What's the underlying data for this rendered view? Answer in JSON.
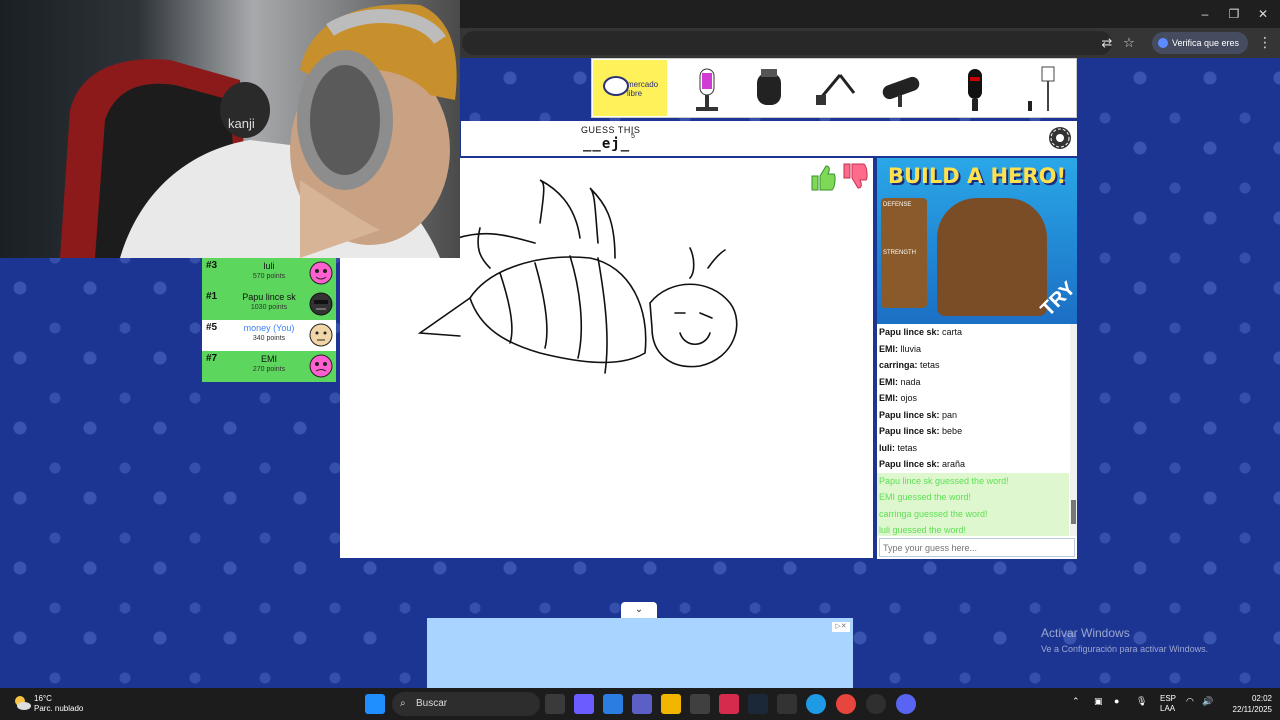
{
  "browser": {
    "window_controls": [
      "–",
      "❐",
      "✕"
    ],
    "verify_label": "Verifica que eres tú"
  },
  "ad_top": {
    "logo_text": "mercado libre",
    "icon": "mercado-libre-logo"
  },
  "game": {
    "guess_label": "GUESS THIS",
    "word_hint": "__ej_",
    "word_length": "5"
  },
  "players": [
    {
      "rank": "#3",
      "name": "luli",
      "points": "570 points",
      "you": false,
      "avatar": "#ff5fcf"
    },
    {
      "rank": "#1",
      "name": "Papu lince sk",
      "points": "1030 points",
      "you": false,
      "avatar": "#333333"
    },
    {
      "rank": "#5",
      "name": "money (You)",
      "points": "340 points",
      "you": true,
      "avatar": "#f3d6a8"
    },
    {
      "rank": "#7",
      "name": "EMI",
      "points": "270 points",
      "you": false,
      "avatar": "#ff5fcf"
    }
  ],
  "ad_right": {
    "title": "BUILD A HERO!",
    "try_label": "TRY",
    "defense_label": "DEFENSE",
    "strength_label": "STRENGTH"
  },
  "chat": {
    "messages": [
      {
        "user": "Papu lince sk:",
        "text": "carta",
        "guessed": false
      },
      {
        "user": "EMI:",
        "text": "lluvia",
        "guessed": false
      },
      {
        "user": "carringa:",
        "text": "tetas",
        "guessed": false
      },
      {
        "user": "EMI:",
        "text": "nada",
        "guessed": false
      },
      {
        "user": "EMI:",
        "text": "ojos",
        "guessed": false
      },
      {
        "user": "Papu lince sk:",
        "text": "pan",
        "guessed": false
      },
      {
        "user": "Papu lince sk:",
        "text": "bebe",
        "guessed": false
      },
      {
        "user": "luli:",
        "text": "tetas",
        "guessed": false
      },
      {
        "user": "Papu lince sk:",
        "text": "araña",
        "guessed": false
      },
      {
        "user": "",
        "text": "Papu lince sk guessed the word!",
        "guessed": true
      },
      {
        "user": "",
        "text": "EMI guessed the word!",
        "guessed": true
      },
      {
        "user": "",
        "text": "carringa guessed the word!",
        "guessed": true
      },
      {
        "user": "",
        "text": "luli guessed the word!",
        "guessed": true
      }
    ],
    "input_placeholder": "Type your guess here..."
  },
  "watermark": {
    "title": "Activar Windows",
    "subtitle": "Ve a Configuración para activar Windows."
  },
  "taskbar": {
    "temperature": "16°C",
    "weather": "Parc. nublado",
    "search_label": "Buscar",
    "lang_top": "ESP",
    "lang_bottom": "LAA",
    "time": "02:02",
    "date": "22/11/2025"
  },
  "webcam": {
    "chair_brand": "kanji"
  },
  "colors": {
    "player_green": "#5cd65c",
    "page_blue": "#1d3592",
    "guessed_green": "#5ee055",
    "you_blue": "#3b82f6"
  }
}
